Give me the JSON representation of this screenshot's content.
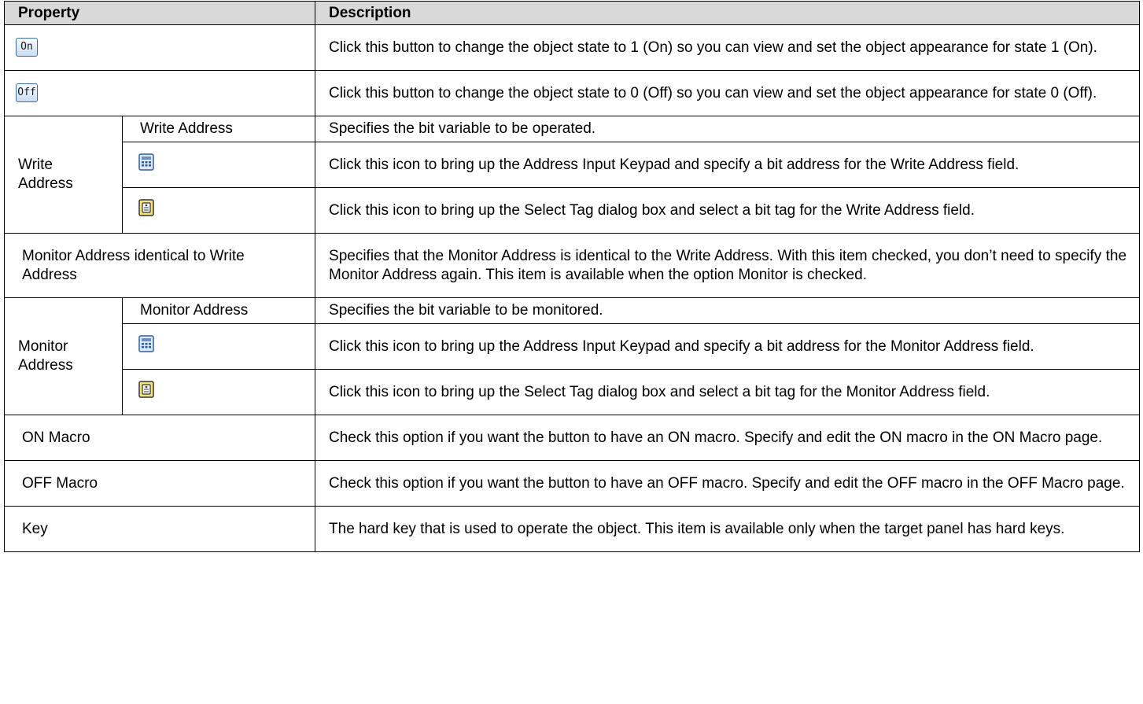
{
  "headers": {
    "property": "Property",
    "description": "Description"
  },
  "icons": {
    "on": "On",
    "off": "Off"
  },
  "rows": {
    "on_desc": "Click this button to change the object state to 1 (On) so you can view and set the object appearance for state 1 (On).",
    "off_desc": "Click this button to change the object state to 0 (Off) so you can view and set the object appearance for state 0 (Off).",
    "write_group": "Write Address",
    "write_address_label": "Write Address",
    "write_address_desc": "Specifies the bit variable to be operated.",
    "write_keypad_desc": "Click this icon to bring up the Address Input Keypad and specify a bit address for the Write Address field.",
    "write_tag_desc": "Click this icon to bring up the Select Tag dialog box and select a bit tag for the Write Address field.",
    "identical_label": "Monitor Address identical to Write Address",
    "identical_desc": "Specifies that the Monitor Address is identical to the Write Address. With this item checked, you don’t need to specify the Monitor Address again. This item is available when the option Monitor is checked.",
    "monitor_group": "Monitor Address",
    "monitor_address_label": "Monitor Address",
    "monitor_address_desc": "Specifies the bit variable to be monitored.",
    "monitor_keypad_desc": "Click this icon to bring up the Address Input Keypad and specify a bit address for the Monitor Address field.",
    "monitor_tag_desc": "Click this icon to bring up the Select Tag dialog box and select a bit tag for the Monitor Address field.",
    "on_macro_label": "ON Macro",
    "on_macro_desc": "Check this option if you want the button to have an ON macro. Specify and edit the ON macro in the ON Macro page.",
    "off_macro_label": "OFF Macro",
    "off_macro_desc": "Check this option if you want the button to have an OFF macro. Specify and edit the OFF macro in the OFF Macro page.",
    "key_label": "Key",
    "key_desc": "The hard key that is used to operate the object. This item is available only when the target panel has hard keys."
  }
}
